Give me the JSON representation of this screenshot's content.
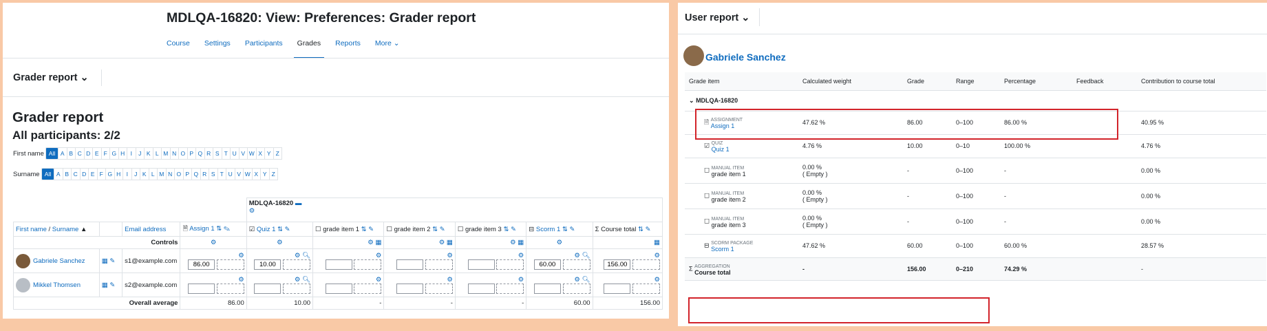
{
  "left": {
    "title": "MDLQA-16820: View: Preferences: Grader report",
    "nav": [
      "Course",
      "Settings",
      "Participants",
      "Grades",
      "Reports",
      "More ⌄"
    ],
    "report_select": "Grader report ⌄",
    "heading": "Grader report",
    "subheading": "All participants: 2/2",
    "firstname_label": "First name",
    "surname_label": "Surname",
    "letters": [
      "All",
      "A",
      "B",
      "C",
      "D",
      "E",
      "F",
      "G",
      "H",
      "I",
      "J",
      "K",
      "L",
      "M",
      "N",
      "O",
      "P",
      "Q",
      "R",
      "S",
      "T",
      "U",
      "V",
      "W",
      "X",
      "Y",
      "Z"
    ],
    "course_name": "MDLQA-16820",
    "col_name": "First name / Surname",
    "col_name_first": "First name",
    "col_name_sep": " / ",
    "col_name_last": "Surname",
    "col_email": "Email address",
    "items": [
      "Assign 1",
      "Quiz 1",
      "grade item 1",
      "grade item 2",
      "grade item 3",
      "Scorm 1",
      "Course total"
    ],
    "controls": "Controls",
    "users": [
      {
        "name": "Gabriele Sanchez",
        "email": "s1@example.com",
        "grades": [
          "86.00",
          "10.00",
          "",
          "",
          "",
          "60.00",
          "156.00"
        ]
      },
      {
        "name": "Mikkel Thomsen",
        "email": "s2@example.com",
        "grades": [
          "",
          "",
          "",
          "",
          "",
          "",
          ""
        ]
      }
    ],
    "overall": "Overall average",
    "averages": [
      "86.00",
      "10.00",
      "-",
      "-",
      "-",
      "60.00",
      "156.00"
    ]
  },
  "right": {
    "report_select": "User report ⌄",
    "user": "Gabriele Sanchez",
    "headers": [
      "Grade item",
      "Calculated weight",
      "Grade",
      "Range",
      "Percentage",
      "Feedback",
      "Contribution to course total"
    ],
    "category": "MDLQA-16820",
    "rows": [
      {
        "type": "ASSIGNMENT",
        "name": "Assign 1",
        "weight": "47.62 %",
        "weight2": "",
        "grade": "86.00",
        "range": "0–100",
        "pct": "86.00 %",
        "contrib": "40.95 %",
        "link": true
      },
      {
        "type": "QUIZ",
        "name": "Quiz 1",
        "weight": "4.76 %",
        "weight2": "",
        "grade": "10.00",
        "range": "0–10",
        "pct": "100.00 %",
        "contrib": "4.76 %",
        "link": true
      },
      {
        "type": "MANUAL ITEM",
        "name": "grade item 1",
        "weight": "0.00 %",
        "weight2": "( Empty )",
        "grade": "-",
        "range": "0–100",
        "pct": "-",
        "contrib": "0.00 %",
        "link": false
      },
      {
        "type": "MANUAL ITEM",
        "name": "grade item 2",
        "weight": "0.00 %",
        "weight2": "( Empty )",
        "grade": "-",
        "range": "0–100",
        "pct": "-",
        "contrib": "0.00 %",
        "link": false
      },
      {
        "type": "MANUAL ITEM",
        "name": "grade item 3",
        "weight": "0.00 %",
        "weight2": "( Empty )",
        "grade": "-",
        "range": "0–100",
        "pct": "-",
        "contrib": "0.00 %",
        "link": false
      },
      {
        "type": "SCORM PACKAGE",
        "name": "Scorm 1",
        "weight": "47.62 %",
        "weight2": "",
        "grade": "60.00",
        "range": "0–100",
        "pct": "60.00 %",
        "contrib": "28.57 %",
        "link": true
      }
    ],
    "total": {
      "type": "AGGREGATION",
      "name": "Course total",
      "weight": "-",
      "grade": "156.00",
      "range": "0–210",
      "pct": "74.29 %",
      "contrib": "-"
    }
  },
  "colors": {
    "link": "#0f6cbf",
    "highlight": "#d2232a",
    "background": "#f9c9a6"
  }
}
